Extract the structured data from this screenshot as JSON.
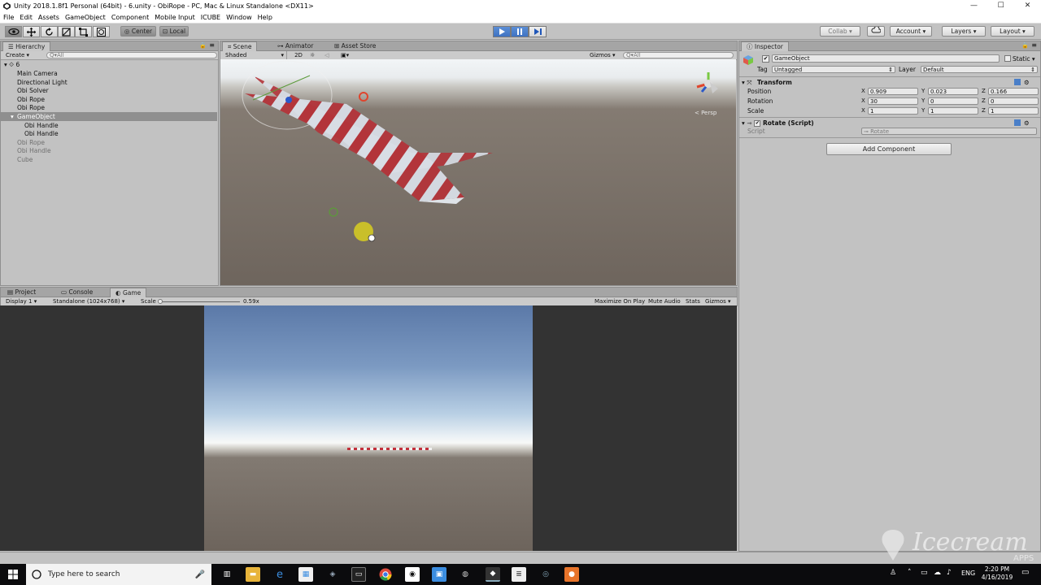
{
  "window": {
    "title": "Unity 2018.1.8f1 Personal (64bit) - 6.unity - ObiRope - PC, Mac & Linux Standalone <DX11>",
    "min": "—",
    "max": "☐",
    "close": "✕"
  },
  "menu": [
    "File",
    "Edit",
    "Assets",
    "GameObject",
    "Component",
    "Mobile Input",
    "ICUBE",
    "Window",
    "Help"
  ],
  "toolbar": {
    "pivot": "Center",
    "space": "Local",
    "collab": "Collab ▾",
    "account": "Account",
    "layers": "Layers",
    "layout": "Layout"
  },
  "hierarchy": {
    "tab": "Hierarchy",
    "create": "Create ▾",
    "search": "Q▾All",
    "scene": "6",
    "items": [
      {
        "label": "Main Camera",
        "indent": 0,
        "state": "normal"
      },
      {
        "label": "Directional Light",
        "indent": 0,
        "state": "normal"
      },
      {
        "label": "Obi Solver",
        "indent": 0,
        "state": "normal"
      },
      {
        "label": "Obi Rope",
        "indent": 0,
        "state": "normal"
      },
      {
        "label": "Obi Rope",
        "indent": 0,
        "state": "normal"
      },
      {
        "label": "GameObject",
        "indent": 0,
        "state": "selected"
      },
      {
        "label": "Obi Handle",
        "indent": 1,
        "state": "normal"
      },
      {
        "label": "Obi Handle",
        "indent": 1,
        "state": "normal"
      },
      {
        "label": "Obi Rope",
        "indent": 0,
        "state": "dim"
      },
      {
        "label": "Obi Handle",
        "indent": 0,
        "state": "dim"
      },
      {
        "label": "Cube",
        "indent": 0,
        "state": "dim"
      }
    ]
  },
  "scene_panel": {
    "tabs": [
      "Scene",
      "Animator",
      "Asset Store"
    ],
    "shading": "Shaded",
    "mode2d": "2D",
    "gizmos": "Gizmos ▾",
    "search": "Q▾All",
    "persp": "< Persp"
  },
  "bottom_panel": {
    "tabs": [
      "Project",
      "Console",
      "Game"
    ],
    "display": "Display 1",
    "resolution": "Standalone (1024x768)",
    "scale_label": "Scale",
    "scale_value": "0.59x",
    "maximize": "Maximize On Play",
    "mute": "Mute Audio",
    "stats": "Stats",
    "gizmos": "Gizmos ▾"
  },
  "inspector": {
    "tab": "Inspector",
    "object_name": "GameObject",
    "static_label": "Static ▾",
    "tag_label": "Tag",
    "tag_value": "Untagged",
    "layer_label": "Layer",
    "layer_value": "Default",
    "transform": {
      "title": "Transform",
      "position": {
        "label": "Position",
        "x": "0.909",
        "y": "0.023",
        "z": "0.166"
      },
      "rotation": {
        "label": "Rotation",
        "x": "30",
        "y": "0",
        "z": "0"
      },
      "scale": {
        "label": "Scale",
        "x": "1",
        "y": "1",
        "z": "1"
      }
    },
    "script_component": {
      "title": "Rotate (Script)",
      "script_label": "Script",
      "script_value": "⊸ Rotate"
    },
    "add_component": "Add Component"
  },
  "watermark": "Icecream",
  "watermark_sub": "APPS",
  "taskbar": {
    "search_placeholder": "Type here to search",
    "lang": "ENG",
    "time": "2:20 PM",
    "date": "4/16/2019"
  }
}
